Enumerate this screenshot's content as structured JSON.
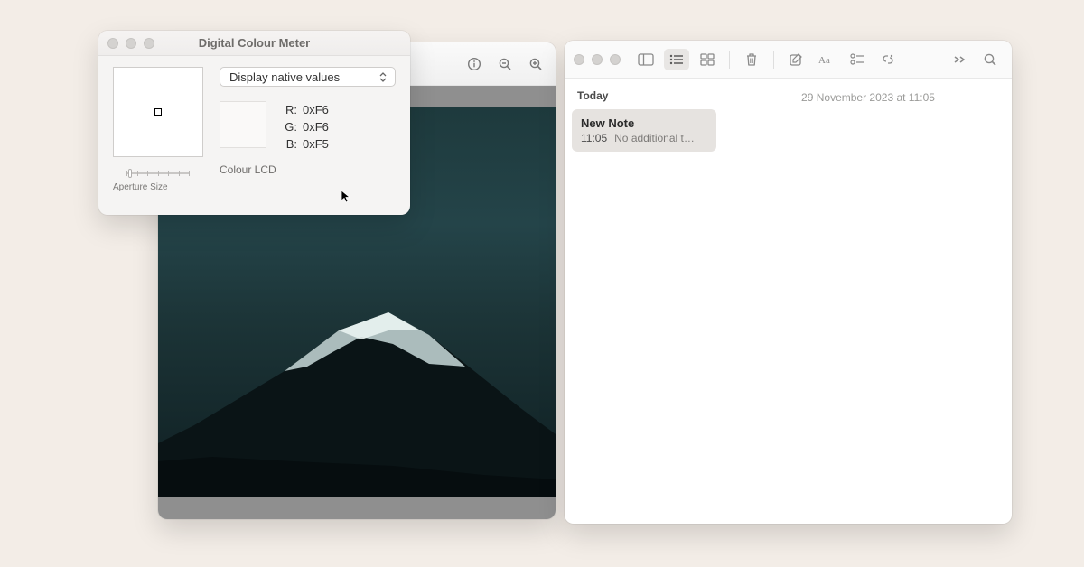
{
  "dcm": {
    "title": "Digital Colour Meter",
    "mode_label": "Display native values",
    "r_label": "R:",
    "g_label": "G:",
    "b_label": "B:",
    "r_value": "0xF6",
    "g_value": "0xF6",
    "b_value": "0xF5",
    "profile": "Colour LCD",
    "aperture_label": "Aperture Size"
  },
  "notes": {
    "section_today": "Today",
    "item": {
      "title": "New Note",
      "time": "11:05",
      "preview": "No additional t…"
    },
    "editor_date": "29 November 2023 at 11:05"
  }
}
